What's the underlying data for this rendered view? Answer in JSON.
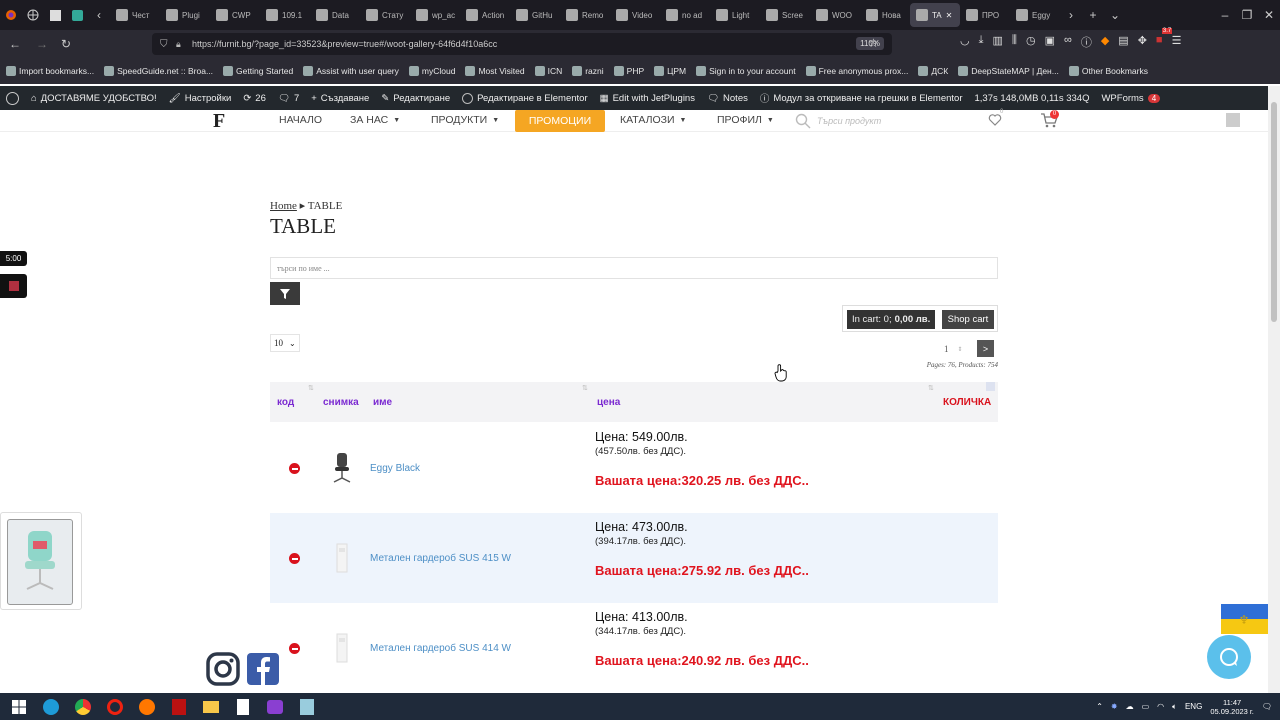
{
  "browser": {
    "tabs": [
      {
        "label": "Чест",
        "icon": "podcast-icon"
      },
      {
        "label": "Plugi",
        "icon": "wordpress-icon"
      },
      {
        "label": "CWP",
        "icon": "wordpress-icon"
      },
      {
        "label": "109.1",
        "icon": "chart-icon"
      },
      {
        "label": "Data",
        "icon": "page-icon"
      },
      {
        "label": "Стату",
        "icon": "page-icon"
      },
      {
        "label": "wp_ac",
        "icon": "google-icon"
      },
      {
        "label": "Action",
        "icon": "github-icon"
      },
      {
        "label": "GitHu",
        "icon": "github-icon"
      },
      {
        "label": "Remo",
        "icon": "page-icon"
      },
      {
        "label": "Video",
        "icon": "video-icon"
      },
      {
        "label": "no ad",
        "icon": "plugin-icon"
      },
      {
        "label": "Light",
        "icon": "pen-icon"
      },
      {
        "label": "Scree",
        "icon": "pen-icon"
      },
      {
        "label": "WOO",
        "icon": "page-icon"
      },
      {
        "label": "Нова",
        "icon": "page-icon"
      },
      {
        "label": "TA",
        "icon": "page-icon"
      },
      {
        "label": "ПРО",
        "icon": "page-icon"
      },
      {
        "label": "Eggy",
        "icon": "page-icon"
      }
    ],
    "url": "https://furnit.bg/?page_id=33523&preview=true#/woot-gallery-64f6d4f10a6cc",
    "zoom": "110%",
    "bookmarks": [
      "Import bookmarks...",
      "SpeedGuide.net :: Broa...",
      "Getting Started",
      "Assist with user query",
      "myCloud",
      "Most Visited",
      "ICN",
      "razni",
      "PHP",
      "ЦРМ",
      "Sign in to your account",
      "Free anonymous prox...",
      "ДСК",
      "DeepStateMAP | Ден...",
      "Other Bookmarks"
    ],
    "ext_badge": "3.7"
  },
  "wpbar": {
    "site": "ДОСТАВЯМЕ УДОБСТВО!",
    "customize": "Настройки",
    "updates": "26",
    "comments": "7",
    "new": "Създаване",
    "edit": "Редактиране",
    "elementor": "Редактиране в Elementor",
    "jetplugins": "Edit with JetPlugins",
    "notes": "Notes",
    "debug": "Модул за откриване на грешки в Elementor",
    "stats": "1,37s  148,0MB  0,11s  334Q",
    "wpforms": "WPForms",
    "wpforms_count": "4"
  },
  "site": {
    "logo": "F",
    "menu": {
      "home": "НАЧАЛО",
      "about": "ЗА НАС",
      "products": "ПРОДУКТИ",
      "promo": "ПРОМОЦИИ",
      "catalogs": "КАТАЛОЗИ",
      "profile": "ПРОФИЛ"
    },
    "search_placeholder": "Търси продукт",
    "wish_count": "0",
    "cart_count": "0"
  },
  "page": {
    "breadcrumb_home": "Home",
    "breadcrumb_sep": "▸",
    "breadcrumb_current": "TABLE",
    "title": "TABLE",
    "name_placeholder": "търси по име ...",
    "in_cart_label": "In cart: 0;",
    "in_cart_value": "0,00 лв.",
    "shop_cart": "Shop cart",
    "per_page": "10",
    "page_num": "1",
    "next": ">",
    "pages_info": "Pages: 76, Products: 754"
  },
  "table": {
    "headers": {
      "code": "код",
      "photo": "снимка",
      "name": "име",
      "price": "цена",
      "cart": "КОЛИЧКА"
    },
    "rows": [
      {
        "name": "Eggy Black",
        "price": "Цена: 549.00лв.",
        "price_net": "(457.50лв. без ДДС).",
        "your_price": "Вашата цена:320.25 лв. без ДДС..",
        "thumb": "chair"
      },
      {
        "name": "Метален гардероб SUS 415 W",
        "price": "Цена: 473.00лв.",
        "price_net": "(394.17лв. без ДДС).",
        "your_price": "Вашата цена:275.92 лв. без ДДС..",
        "thumb": "locker"
      },
      {
        "name": "Метален гардероб SUS 414 W",
        "price": "Цена: 413.00лв.",
        "price_net": "(344.17лв. без ДДС).",
        "your_price": "Вашата цена:240.92 лв. без ДДС..",
        "thumb": "locker"
      }
    ]
  },
  "overlays": {
    "timer": "5:00"
  },
  "taskbar": {
    "lang": "ENG",
    "time": "11:47",
    "date": "05.09.2023 г."
  },
  "colors": {
    "accent_purple": "#7b2ad1",
    "promo_orange": "#f5a623",
    "price_red": "#e0141e",
    "link_blue": "#4d8fc6"
  }
}
